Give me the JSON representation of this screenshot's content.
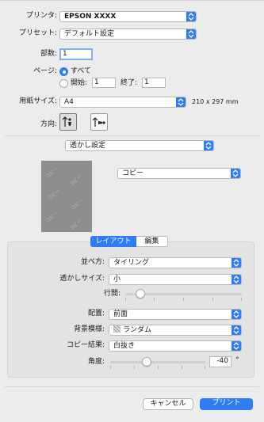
{
  "printer": {
    "label": "プリンタ:",
    "value": "EPSON XXXX"
  },
  "preset": {
    "label": "プリセット:",
    "value": "デフォルト設定"
  },
  "copies": {
    "label": "部数:",
    "value": "1"
  },
  "pages": {
    "label": "ページ:",
    "all": "すべて",
    "from_label": "開始:",
    "from_value": "1",
    "to_label": "終了:",
    "to_value": "1"
  },
  "paper_size": {
    "label": "用紙サイズ:",
    "value": "A4",
    "dims": "210 x 297 mm"
  },
  "orientation": {
    "label": "方向:"
  },
  "section_popup": {
    "value": "透かし設定"
  },
  "watermark": {
    "text_popup": "コピー",
    "preview_text": "コピー"
  },
  "tabs": {
    "layout": "レイアウト",
    "edit": "編集"
  },
  "panel": {
    "arrangement": {
      "label": "並べ方:",
      "value": "タイリング"
    },
    "watermark_size": {
      "label": "透かしサイズ:",
      "value": "小"
    },
    "line_spacing": {
      "label": "行間:",
      "level": 0.13
    },
    "placement": {
      "label": "配置:",
      "value": "前面"
    },
    "background_pattern": {
      "label": "背景模様:",
      "value": "ランダム"
    },
    "copy_result": {
      "label": "コピー結果:",
      "value": "白抜き"
    },
    "angle": {
      "label": "角度:",
      "value": "-40",
      "unit": "°"
    }
  },
  "buttons": {
    "cancel": "キャンセル",
    "print": "プリント"
  },
  "colors": {
    "accent": "#2e7cf6",
    "background": "#ececec",
    "panel": "#e3e3e3"
  }
}
